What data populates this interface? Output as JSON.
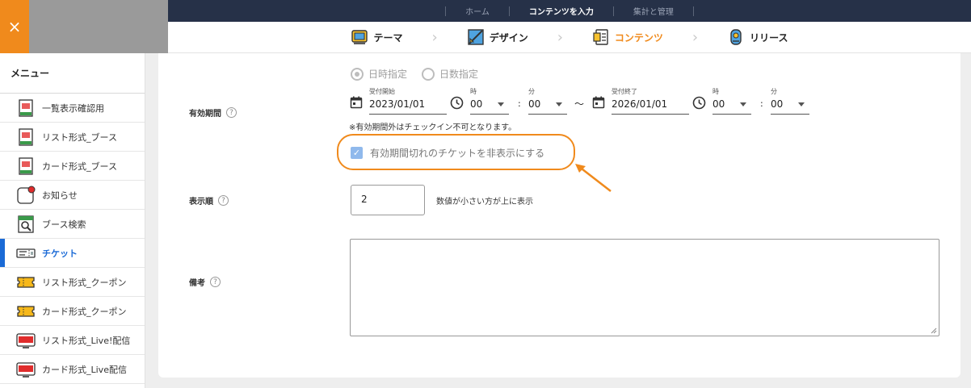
{
  "header": {
    "close_symbol": "×",
    "topnav": [
      "ホーム",
      "コンテンツを入力",
      "集計と管理"
    ],
    "steps": [
      {
        "label": "テーマ",
        "icon": "theme-icon"
      },
      {
        "label": "デザイン",
        "icon": "design-icon"
      },
      {
        "label": "コンテンツ",
        "icon": "contents-icon"
      },
      {
        "label": "リリース",
        "icon": "release-icon"
      }
    ],
    "chevron": "›",
    "accent_color": "#f08a1c",
    "nav_bg": "#263148"
  },
  "sidebar": {
    "title": "メニュー",
    "items": [
      {
        "label": "一覧表示確認用",
        "icon": "booth-icon"
      },
      {
        "label": "リスト形式_ブース",
        "icon": "booth-icon"
      },
      {
        "label": "カード形式_ブース",
        "icon": "booth-icon"
      },
      {
        "label": "お知らせ",
        "icon": "notice-icon"
      },
      {
        "label": "ブース検索",
        "icon": "booth-search-icon"
      },
      {
        "label": "チケット",
        "icon": "ticket-icon"
      },
      {
        "label": "リスト形式_クーポン",
        "icon": "coupon-icon"
      },
      {
        "label": "カード形式_クーポン",
        "icon": "coupon-icon"
      },
      {
        "label": "リスト形式_Live!配信",
        "icon": "live-icon"
      },
      {
        "label": "カード形式_Live配信",
        "icon": "live-icon"
      }
    ],
    "active_color": "#1a6ad6"
  },
  "form": {
    "validity": {
      "label": "有効期間",
      "help": "?",
      "radio_datetime": "日時指定",
      "radio_days": "日数指定",
      "start_label": "受付開始",
      "start_date": "2023/01/01",
      "hour_label": "時",
      "minute_label": "分",
      "start_hour": "00",
      "start_minute": "00",
      "colon": ":",
      "tilde": "〜",
      "end_label": "受付終了",
      "end_date": "2026/01/01",
      "end_hour": "00",
      "end_minute": "00",
      "note": "※有効期間外はチェックイン不可となります。",
      "hide_expired_label": "有効期間切れのチケットを非表示にする",
      "check_mark": "✓"
    },
    "order": {
      "label": "表示順",
      "help": "?",
      "value": "2",
      "hint": "数値が小さい方が上に表示"
    },
    "remarks": {
      "label": "備考",
      "help": "?",
      "value": ""
    }
  }
}
